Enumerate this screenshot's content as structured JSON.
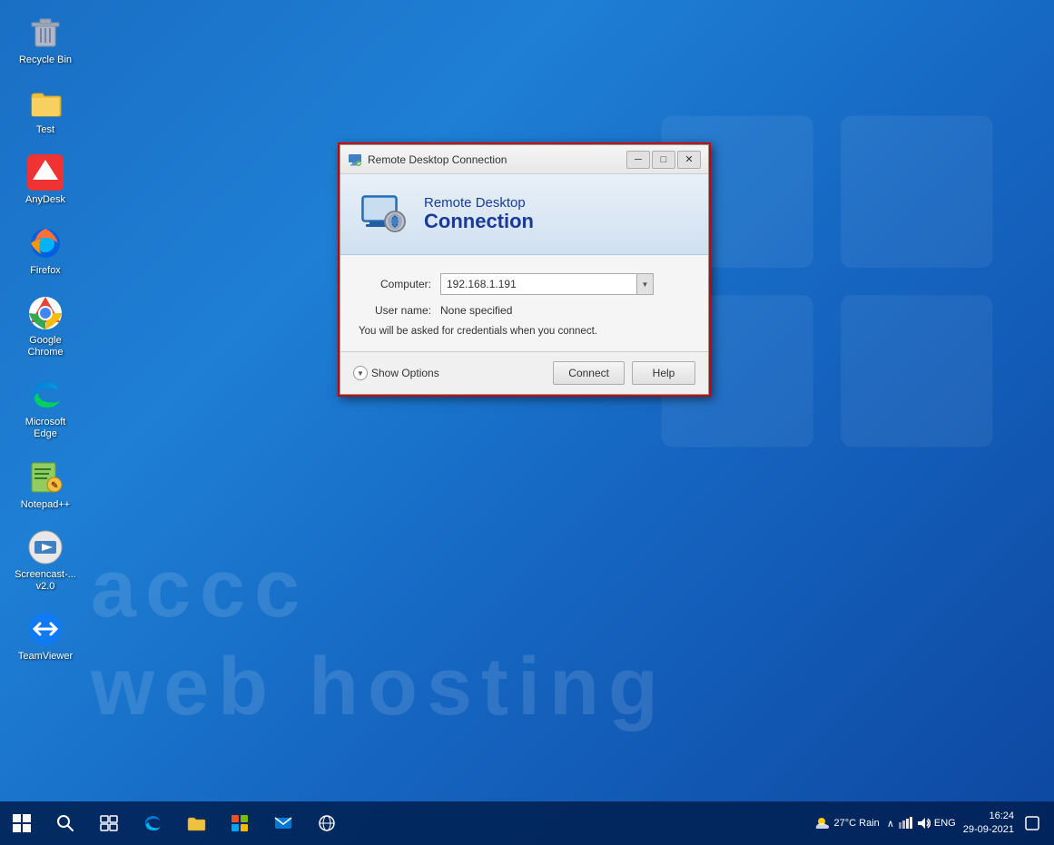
{
  "desktop": {
    "icons": [
      {
        "id": "recycle-bin",
        "label": "Recycle Bin",
        "icon": "🗑️"
      },
      {
        "id": "test",
        "label": "Test",
        "icon": "📁"
      },
      {
        "id": "anydesk",
        "label": "AnyDesk",
        "icon": "⬡"
      },
      {
        "id": "firefox",
        "label": "Firefox",
        "icon": "🦊"
      },
      {
        "id": "google-chrome",
        "label": "Google Chrome",
        "icon": "⊙"
      },
      {
        "id": "microsoft-edge",
        "label": "Microsoft Edge",
        "icon": "◉"
      },
      {
        "id": "notepadpp",
        "label": "Notepad++",
        "icon": "📝"
      },
      {
        "id": "screencast",
        "label": "Screencast-... v2.0",
        "icon": "🎬"
      },
      {
        "id": "teamviewer",
        "label": "TeamViewer",
        "icon": "⇄"
      }
    ],
    "watermark_line1": "accc",
    "watermark_line2": "web hosting"
  },
  "dialog": {
    "title": "Remote Desktop Connection",
    "header_line1": "Remote Desktop",
    "header_line2": "Connection",
    "fields": {
      "computer_label": "Computer:",
      "computer_value": "192.168.1.191",
      "username_label": "User name:",
      "username_value": "None specified",
      "note": "You will be asked for credentials when you connect."
    },
    "show_options": "Show Options",
    "connect_button": "Connect",
    "help_button": "Help"
  },
  "taskbar": {
    "weather": "27°C Rain",
    "language": "ENG",
    "time": "16:24",
    "date": "29-09-2021"
  }
}
